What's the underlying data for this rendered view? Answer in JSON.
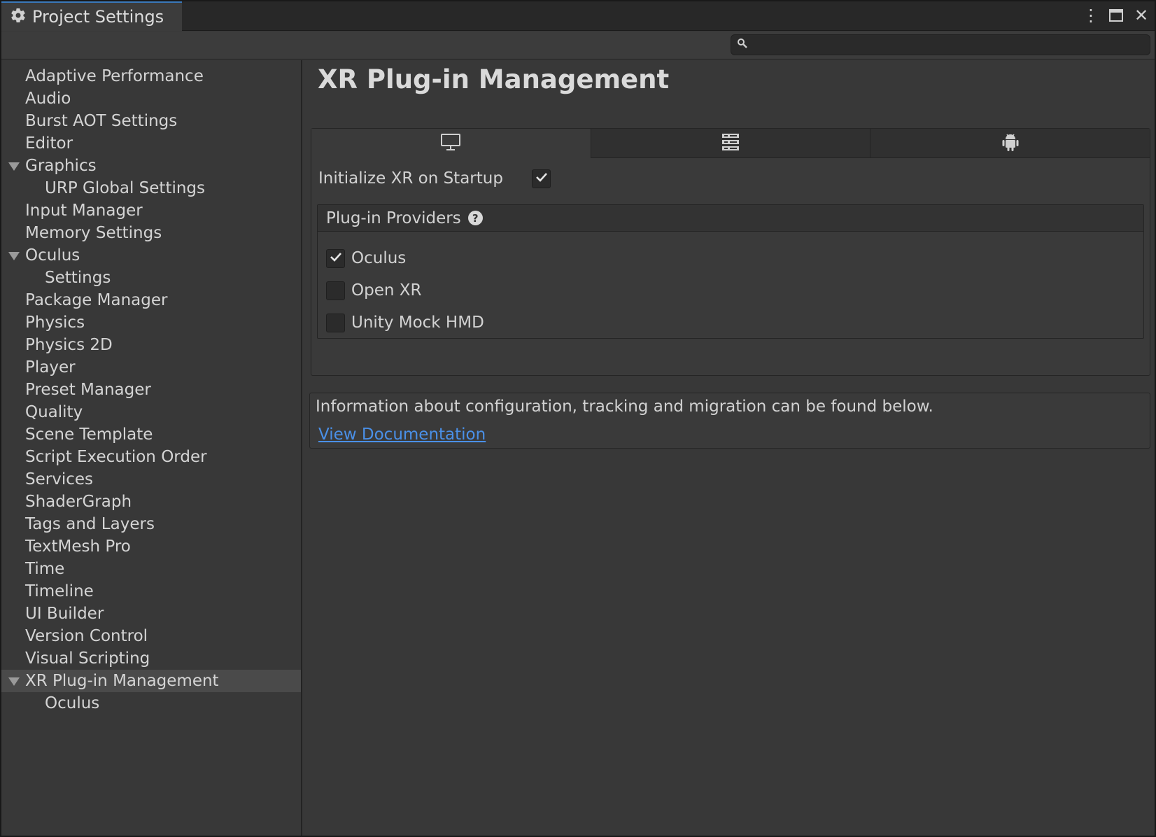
{
  "window": {
    "title": "Project Settings",
    "title_icon": "gear-icon",
    "controls": [
      {
        "name": "more-options-icon",
        "glyph": "⋮"
      },
      {
        "name": "maximize-icon",
        "glyph": "□"
      },
      {
        "name": "close-icon",
        "glyph": "✕"
      }
    ]
  },
  "search": {
    "placeholder": "",
    "value": ""
  },
  "sidebar": {
    "items": [
      {
        "label": "Adaptive Performance",
        "level": 0
      },
      {
        "label": "Audio",
        "level": 0
      },
      {
        "label": "Burst AOT Settings",
        "level": 0
      },
      {
        "label": "Editor",
        "level": 0
      },
      {
        "label": "Graphics",
        "level": 0,
        "expanded": true
      },
      {
        "label": "URP Global Settings",
        "level": 1
      },
      {
        "label": "Input Manager",
        "level": 0
      },
      {
        "label": "Memory Settings",
        "level": 0
      },
      {
        "label": "Oculus",
        "level": 0,
        "expanded": true
      },
      {
        "label": "Settings",
        "level": 1
      },
      {
        "label": "Package Manager",
        "level": 0
      },
      {
        "label": "Physics",
        "level": 0
      },
      {
        "label": "Physics 2D",
        "level": 0
      },
      {
        "label": "Player",
        "level": 0
      },
      {
        "label": "Preset Manager",
        "level": 0
      },
      {
        "label": "Quality",
        "level": 0
      },
      {
        "label": "Scene Template",
        "level": 0
      },
      {
        "label": "Script Execution Order",
        "level": 0
      },
      {
        "label": "Services",
        "level": 0
      },
      {
        "label": "ShaderGraph",
        "level": 0
      },
      {
        "label": "Tags and Layers",
        "level": 0
      },
      {
        "label": "TextMesh Pro",
        "level": 0
      },
      {
        "label": "Time",
        "level": 0
      },
      {
        "label": "Timeline",
        "level": 0
      },
      {
        "label": "UI Builder",
        "level": 0
      },
      {
        "label": "Version Control",
        "level": 0
      },
      {
        "label": "Visual Scripting",
        "level": 0
      },
      {
        "label": "XR Plug-in Management",
        "level": 0,
        "expanded": true,
        "selected": true
      },
      {
        "label": "Oculus",
        "level": 1
      }
    ]
  },
  "main": {
    "title": "XR Plug-in Management",
    "platform_tabs": [
      {
        "icon": "desktop-icon",
        "active": true
      },
      {
        "icon": "server-icon",
        "active": false
      },
      {
        "icon": "android-icon",
        "active": false
      }
    ],
    "initialize_label": "Initialize XR on Startup",
    "initialize_checked": true,
    "providers_title": "Plug-in Providers",
    "providers_help_glyph": "?",
    "providers": [
      {
        "label": "Oculus",
        "checked": true
      },
      {
        "label": "Open XR",
        "checked": false
      },
      {
        "label": "Unity Mock HMD",
        "checked": false
      }
    ],
    "info_text": "Information about configuration, tracking and migration can be found below.",
    "doc_link": "View Documentation"
  },
  "colors": {
    "background": "#383838",
    "selected_item": "#4a4a4a",
    "link": "#4a90e8",
    "tab_accent": "#3a79bb"
  }
}
